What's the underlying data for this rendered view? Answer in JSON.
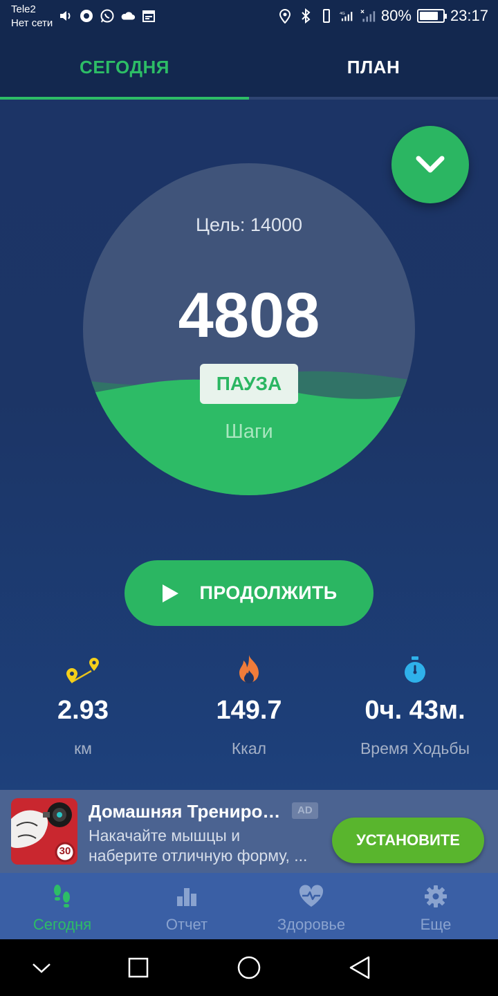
{
  "status_bar": {
    "carrier": "Tele2",
    "network": "Нет сети",
    "battery_percent": "80%",
    "battery_level": 0.8,
    "time": "23:17",
    "icons_left": [
      "volume-icon",
      "record-icon",
      "whatsapp-icon",
      "cloud-icon",
      "calendar-icon"
    ],
    "icons_right": [
      "location-icon",
      "bluetooth-icon",
      "vibrate-icon",
      "signal-4g-icon",
      "signal-icon",
      "battery-icon",
      "leaf-icon"
    ]
  },
  "tabs": [
    {
      "label": "СЕГОДНЯ",
      "active": true
    },
    {
      "label": "ПЛАН",
      "active": false
    }
  ],
  "progress": {
    "goal_label": "Цель: 14000",
    "steps_value": "4808",
    "state_badge": "ПАУЗА",
    "unit_label": "Шаги",
    "fill_fraction": 0.34
  },
  "continue_button": {
    "label": "ПРОДОЛЖИТЬ"
  },
  "stats": [
    {
      "icon": "route-pins-icon",
      "value": "2.93",
      "label": "км"
    },
    {
      "icon": "flame-icon",
      "value": "149.7",
      "label": "Ккал"
    },
    {
      "icon": "stopwatch-icon",
      "value": "0ч. 43м.",
      "label": "Время Ходьбы"
    }
  ],
  "ad": {
    "title": "Домашняя Тренировка",
    "badge": "AD",
    "description_line1": "Накачайте мышцы и",
    "description_line2": "наберите отличную форму, ...",
    "cta": "УСТАНОВИТЕ",
    "thumb_badge": "30"
  },
  "bottom_nav": [
    {
      "label": "Сегодня",
      "icon": "footprints-icon",
      "active": true
    },
    {
      "label": "Отчет",
      "icon": "bar-chart-icon",
      "active": false
    },
    {
      "label": "Здоровье",
      "icon": "heart-pulse-icon",
      "active": false
    },
    {
      "label": "Еще",
      "icon": "gear-icon",
      "active": false
    }
  ],
  "colors": {
    "accent": "#2dbd66",
    "background": "#1c3566",
    "nav": "#3a5fa5"
  }
}
